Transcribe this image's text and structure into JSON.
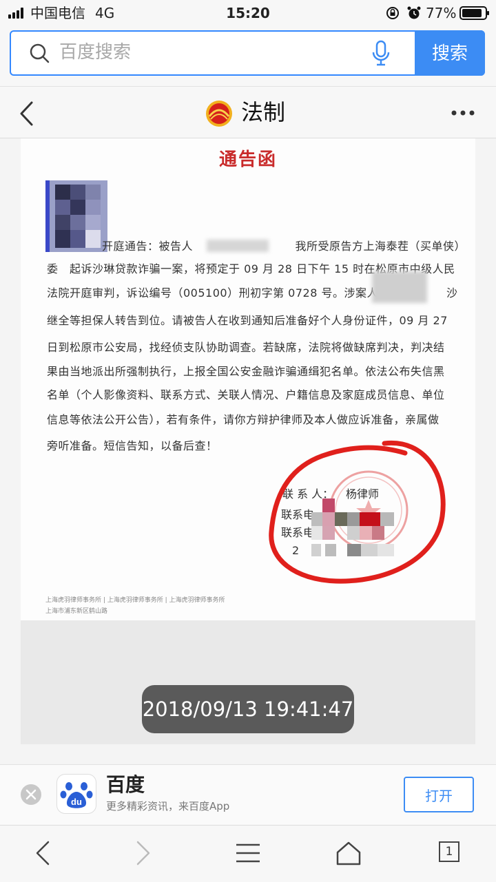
{
  "status_bar": {
    "carrier": "中国电信",
    "network": "4G",
    "time": "15:20",
    "battery": "77%"
  },
  "search": {
    "placeholder": "百度搜索",
    "button_label": "搜索"
  },
  "nav": {
    "title": "法制"
  },
  "document": {
    "title": "通告函",
    "lines": [
      "开庭通告：被告人　　　　　　　　　我所受原告方上海泰茬（买单侠）",
      "委　起诉沙琳贷款诈骗一案，将预定于 09 月 28 日下午 15 时在松原市中级人民",
      "法院开庭审判，诉讼编号（005100）刑初字第 0728 号。涉案人员　　　　　沙",
      "继全等担保人转告到位。请被告人在收到通知后准备好个人身份证件，09 月 27",
      "日到松原市公安局，找经侦支队协助调查。若缺席，法院将做缺席判决，判决结",
      "果由当地派出所强制执行，上报全国公安金融诈骗通缉犯名单。依法公布失信黑",
      "名单（个人影像资料、联系方式、关联人情况、户籍信息及家庭成员信息、单位",
      "信息等依法公开公告），若有条件，请你方辩护律师及本人做应诉准备，亲属做",
      "旁听准备。短信告知，以备后查！"
    ],
    "contact_label": "联 系 人：",
    "contact_name": "杨律师",
    "phone_label_1": "联系电",
    "phone_label_2": "联系电",
    "date_prefix": "2",
    "footer_1": "上海虎羽律师事务所 | 上海虎羽律师事务所 | 上海虎羽律师事务所",
    "footer_2": "上海市浦东新区鹤山路"
  },
  "timestamp": "2018/09/13 19:41:47",
  "banner": {
    "app_name": "百度",
    "tagline": "更多精彩资讯，来百度App",
    "open_label": "打开"
  },
  "toolbar": {
    "tab_count": "1"
  },
  "colors": {
    "accent": "#3c8cf4",
    "title_red": "#c92b2b",
    "marker_red": "#e0201c"
  }
}
